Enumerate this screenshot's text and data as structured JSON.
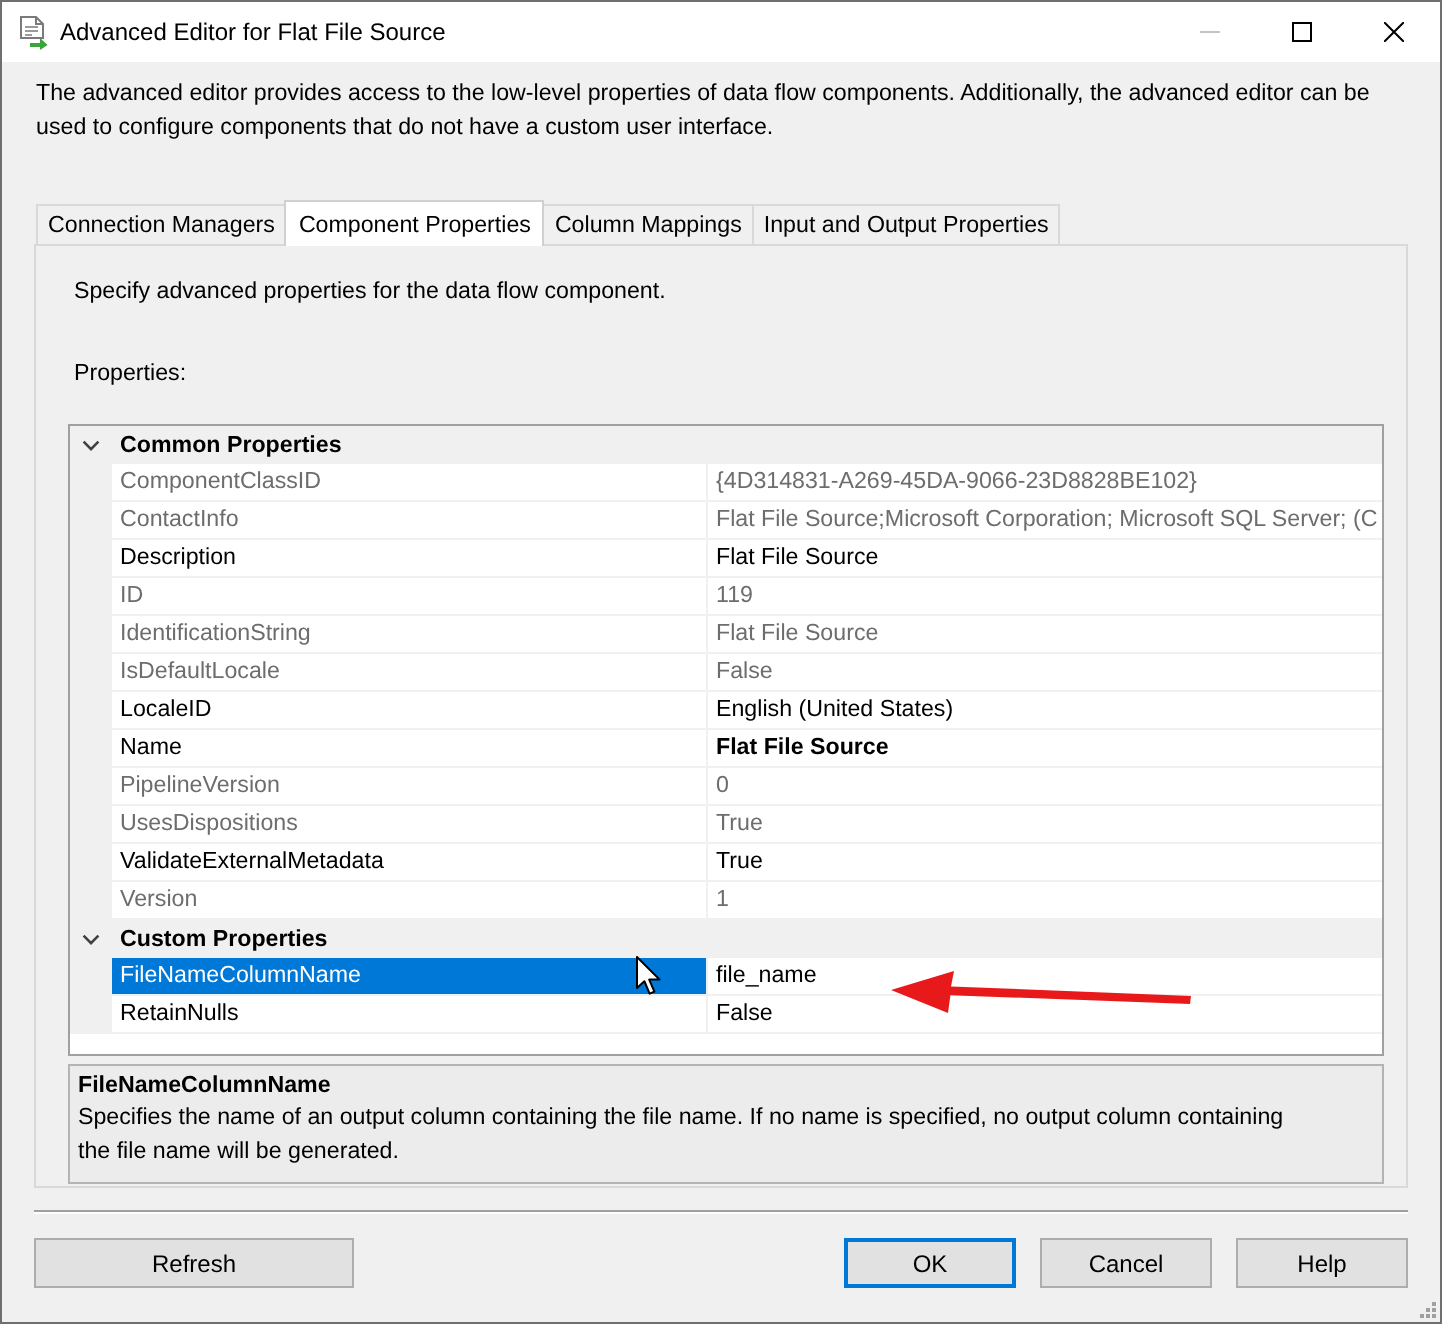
{
  "window": {
    "title": "Advanced Editor for Flat File Source",
    "minimize_enabled": false
  },
  "intro": "The advanced editor provides access to the low-level properties of data flow components. Additionally, the advanced editor can be used to configure components that do not have a custom user interface.",
  "tabs": [
    {
      "label": "Connection Managers",
      "selected": false
    },
    {
      "label": "Component Properties",
      "selected": true
    },
    {
      "label": "Column Mappings",
      "selected": false
    },
    {
      "label": "Input and Output Properties",
      "selected": false
    }
  ],
  "panel": {
    "instruction": "Specify advanced properties for the data flow component.",
    "properties_label": "Properties:"
  },
  "property_grid": {
    "categories": [
      {
        "name": "Common Properties",
        "expanded": true,
        "properties": [
          {
            "name": "ComponentClassID",
            "value": "{4D314831-A269-45DA-9066-23D8828BE102}",
            "read_only": true,
            "non_default": false,
            "selected": false
          },
          {
            "name": "ContactInfo",
            "value": "Flat File Source;Microsoft Corporation; Microsoft SQL Server; (C",
            "read_only": true,
            "non_default": false,
            "selected": false
          },
          {
            "name": "Description",
            "value": "Flat File Source",
            "read_only": false,
            "non_default": false,
            "selected": false
          },
          {
            "name": "ID",
            "value": "119",
            "read_only": true,
            "non_default": false,
            "selected": false
          },
          {
            "name": "IdentificationString",
            "value": "Flat File Source",
            "read_only": true,
            "non_default": false,
            "selected": false
          },
          {
            "name": "IsDefaultLocale",
            "value": "False",
            "read_only": true,
            "non_default": false,
            "selected": false
          },
          {
            "name": "LocaleID",
            "value": "English (United States)",
            "read_only": false,
            "non_default": false,
            "selected": false
          },
          {
            "name": "Name",
            "value": "Flat File Source",
            "read_only": false,
            "non_default": true,
            "selected": false
          },
          {
            "name": "PipelineVersion",
            "value": "0",
            "read_only": true,
            "non_default": false,
            "selected": false
          },
          {
            "name": "UsesDispositions",
            "value": "True",
            "read_only": true,
            "non_default": false,
            "selected": false
          },
          {
            "name": "ValidateExternalMetadata",
            "value": "True",
            "read_only": false,
            "non_default": false,
            "selected": false
          },
          {
            "name": "Version",
            "value": "1",
            "read_only": true,
            "non_default": false,
            "selected": false
          }
        ]
      },
      {
        "name": "Custom Properties",
        "expanded": true,
        "properties": [
          {
            "name": "FileNameColumnName",
            "value": "file_name",
            "read_only": false,
            "non_default": false,
            "selected": true
          },
          {
            "name": "RetainNulls",
            "value": "False",
            "read_only": false,
            "non_default": false,
            "selected": false
          }
        ]
      }
    ]
  },
  "description": {
    "title": "FileNameColumnName",
    "text": "Specifies the name of an output column containing the file name. If no name is specified, no output column containing the file name will be generated."
  },
  "footer": {
    "left_buttons": [
      {
        "label": "Refresh",
        "focused": false
      }
    ],
    "right_buttons": [
      {
        "label": "OK",
        "focused": true
      },
      {
        "label": "Cancel",
        "focused": false
      },
      {
        "label": "Help",
        "focused": false
      }
    ]
  }
}
